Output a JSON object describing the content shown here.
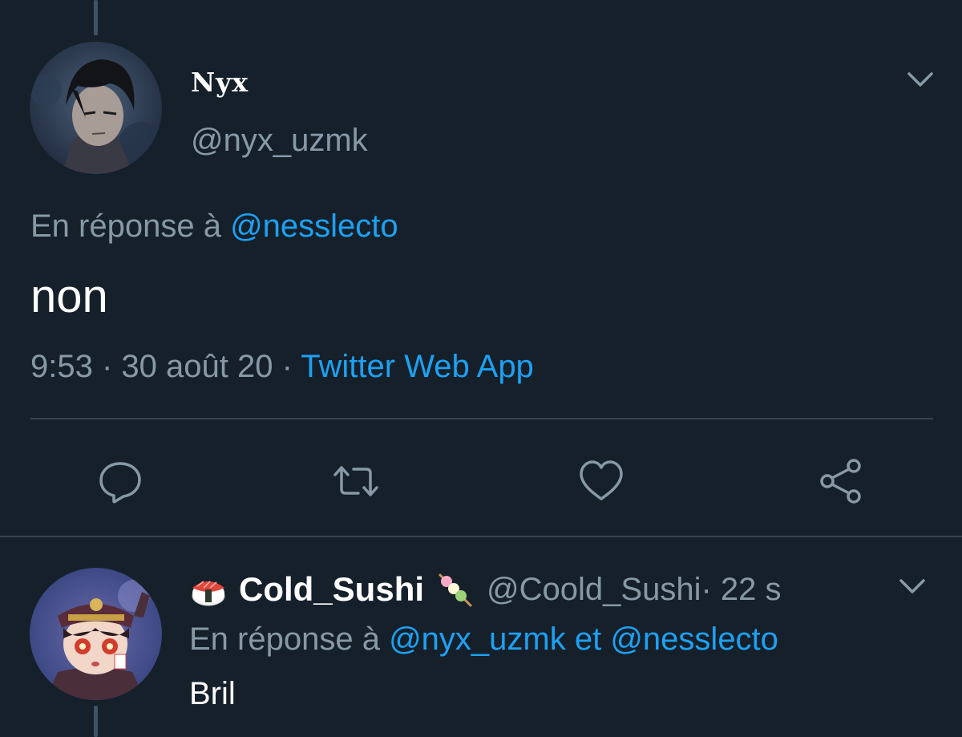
{
  "main_tweet": {
    "author": {
      "display_name": "Nyx",
      "handle": "@nyx_uzmk"
    },
    "reply_to_prefix": "En réponse à ",
    "reply_to_handle": "@nesslecto",
    "text": "non",
    "time_date": "9:53 · 30 août 20 · ",
    "source": "Twitter Web App",
    "actions": [
      "reply-icon",
      "retweet-icon",
      "like-icon",
      "share-icon"
    ]
  },
  "reply_tweet": {
    "author": {
      "display_name": "Cold_Sushi",
      "handle": "@Coold_Sushi",
      "time": " · 22 s",
      "emoji_before": "sushi-emoji",
      "emoji_after": "dango-emoji"
    },
    "reply_to_prefix": "En réponse à ",
    "reply_to_handle_1": "@nyx_uzmk",
    "reply_to_separator": " et ",
    "reply_to_handle_2": "@nesslecto",
    "text": "Bril"
  },
  "colors": {
    "background": "#15202b",
    "accent": "#1da1f2",
    "secondary_text": "#8899a6",
    "divider": "#38444d"
  }
}
